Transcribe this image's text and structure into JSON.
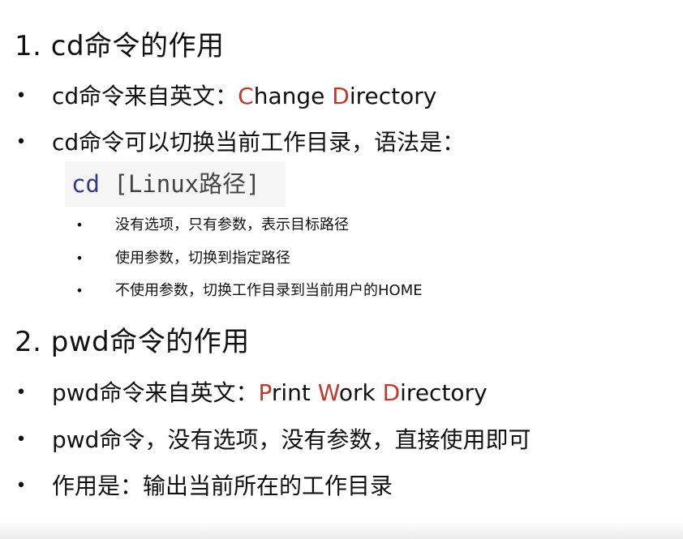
{
  "section1": {
    "heading": "1. cd命令的作用",
    "bullets": [
      {
        "prefix": "cd命令来自英文：",
        "parts": [
          "C",
          "hange ",
          "D",
          "irectory"
        ]
      },
      {
        "text": "cd命令可以切换当前工作目录，语法是："
      }
    ],
    "code": {
      "command": "cd",
      "argument": " [Linux路径]"
    },
    "sub_bullets": [
      "没有选项，只有参数，表示目标路径",
      "使用参数，切换到指定路径",
      "不使用参数，切换工作目录到当前用户的HOME"
    ]
  },
  "section2": {
    "heading": "2. pwd命令的作用",
    "bullets": [
      {
        "prefix": "pwd命令来自英文：",
        "parts": [
          "P",
          "rint ",
          "W",
          "ork ",
          "D",
          "irectory"
        ]
      },
      {
        "text": "pwd命令，没有选项，没有参数，直接使用即可"
      },
      {
        "text": "作用是：输出当前所在的工作目录"
      }
    ]
  },
  "colors": {
    "accent_red": "#c0392b",
    "code_keyword": "#2b3a8f",
    "code_background": "#f6f6f6"
  }
}
